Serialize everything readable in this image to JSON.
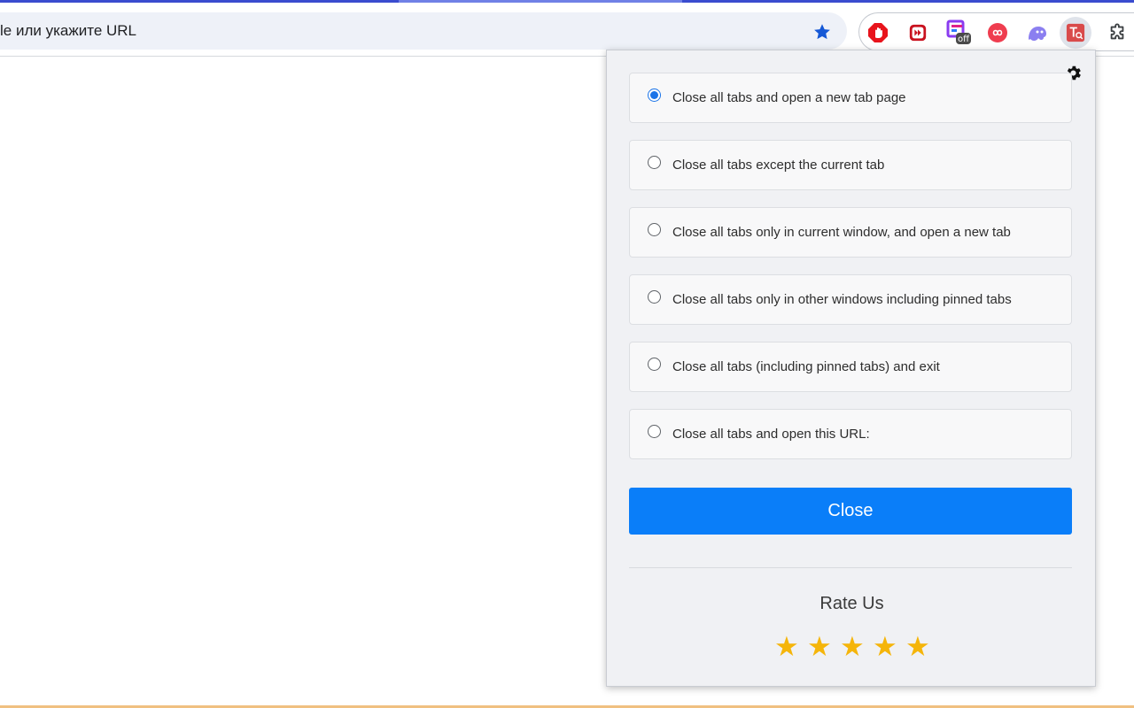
{
  "browser": {
    "address_text": "le или укажите URL",
    "extensions": [
      {
        "icon": "adblock-hand-icon",
        "color": "#e8141c"
      },
      {
        "icon": "media-forward-icon",
        "color": "#c9121f"
      },
      {
        "icon": "tab-manager-off-icon",
        "color": "#8a3cf0",
        "badge": "off"
      },
      {
        "icon": "infinity-icon",
        "color": "#ef3d4f"
      },
      {
        "icon": "ghost-icon",
        "color": "#8b7ff0"
      },
      {
        "icon": "translate-tabs-icon",
        "color": "#d94b4b"
      },
      {
        "icon": "puzzle-extensions-icon",
        "color": "#3c4043"
      }
    ]
  },
  "popup": {
    "options": [
      {
        "label": "Close all tabs and open a new tab page",
        "checked": true
      },
      {
        "label": "Close all tabs except the current tab",
        "checked": false
      },
      {
        "label": "Close all tabs only in current window, and open a new tab",
        "checked": false
      },
      {
        "label": "Close all tabs only in other windows including pinned tabs",
        "checked": false
      },
      {
        "label": "Close all tabs (including pinned tabs) and exit",
        "checked": false
      },
      {
        "label": "Close all tabs and open this URL:",
        "checked": false
      }
    ],
    "close_label": "Close",
    "rate_title": "Rate Us",
    "rating_stars": 5,
    "colors": {
      "accent_button": "#0a7ef9",
      "star": "#f5b50a",
      "radio_checked": "#1a73e8"
    }
  }
}
